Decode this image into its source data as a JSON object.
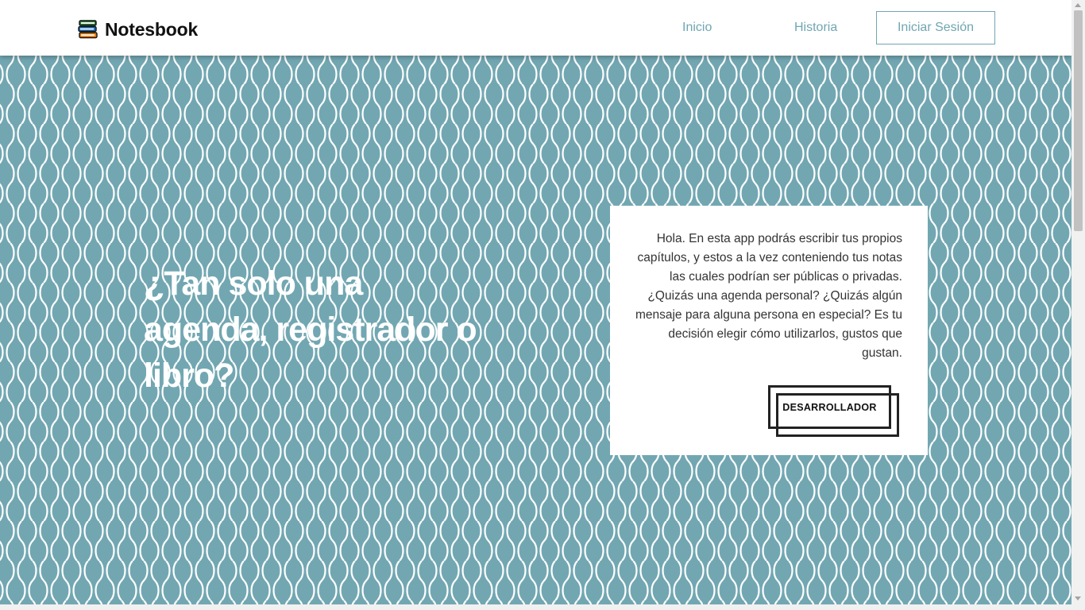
{
  "header": {
    "brand_name": "Notesbook",
    "brand_icon": "book-stack-icon",
    "nav": {
      "home_label": "Inicio",
      "history_label": "Historia",
      "login_label": "Iniciar Sesión"
    }
  },
  "hero": {
    "headline": "¿Tan solo una agenda, registrador o libro?",
    "description": "Hola. En esta app podrás escribir tus propios capítulos, y estos a la vez conteniendo tus notas las cuales podrían ser públicas o privadas. ¿Quizás una agenda personal? ¿Quizás algún mensaje para alguna persona en especial? Es tu decisión elegir cómo utilizarlos, gustos que gustan.",
    "developer_button_label": "DESARROLLADOR"
  },
  "colors": {
    "accent": "#6fa6b2",
    "hero_background": "#72a7b2",
    "pattern_stroke": "#ffffff",
    "text_dark": "#111111"
  }
}
